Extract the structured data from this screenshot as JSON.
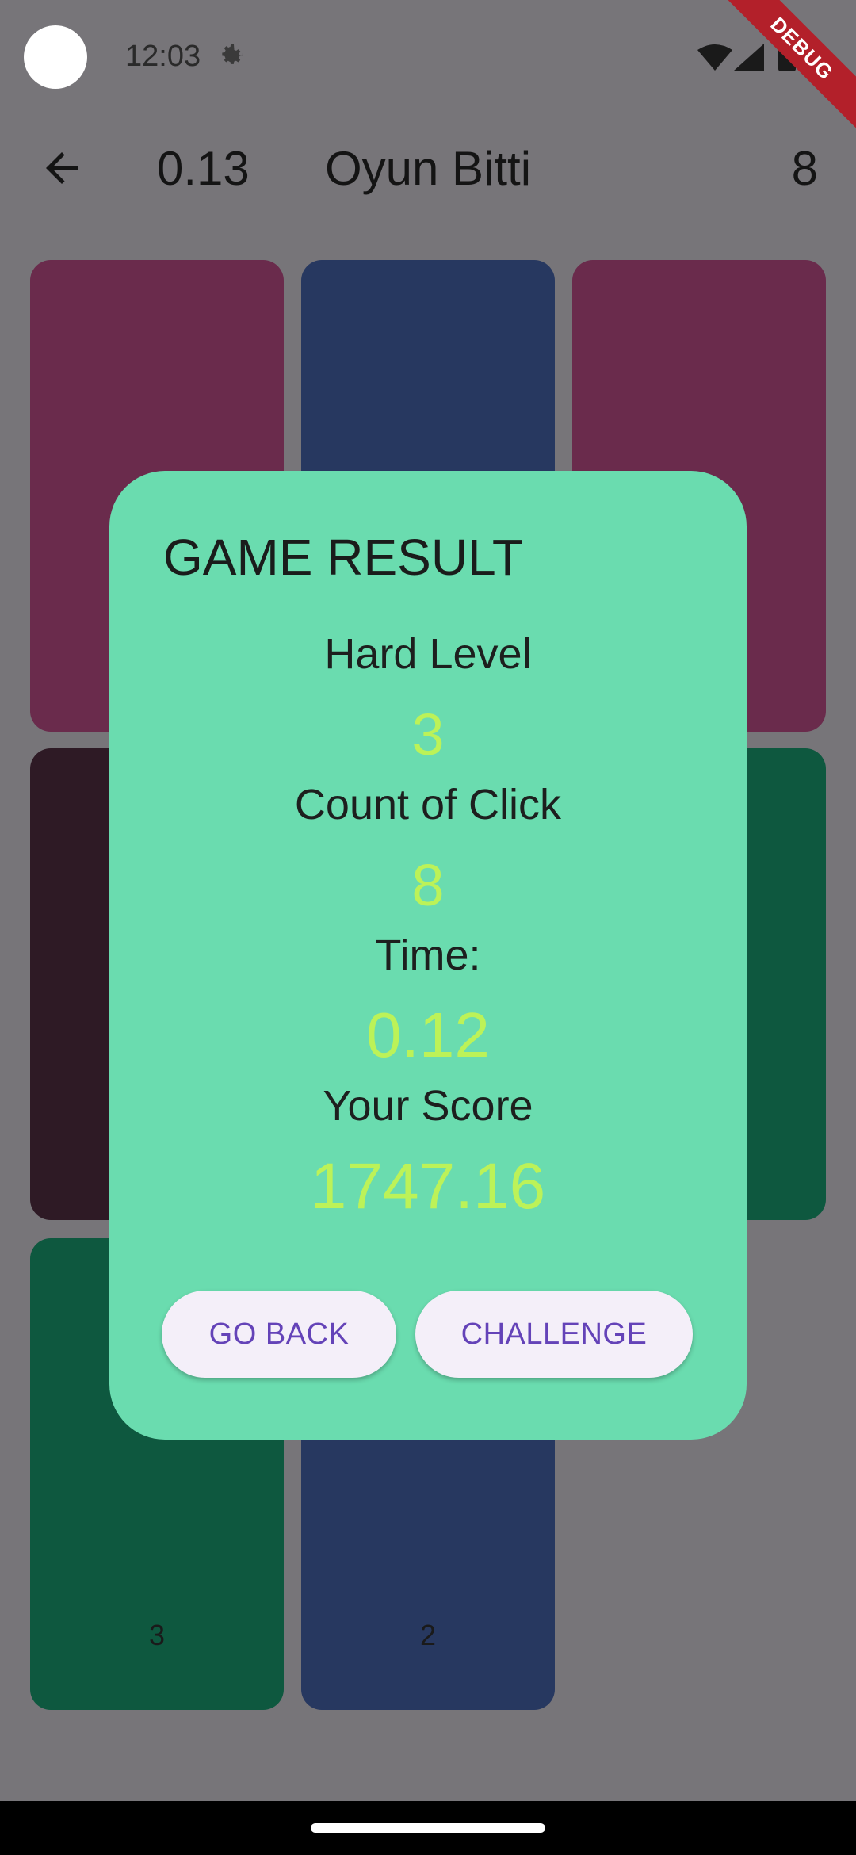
{
  "status_bar": {
    "time": "12:03",
    "icons": [
      "gear-icon",
      "wifi-icon",
      "signal-icon",
      "battery-icon"
    ],
    "debug_label": "DEBUG"
  },
  "app_bar": {
    "back_icon": "arrow-left-icon",
    "time_value": "0.13",
    "title": "Oyun Bitti",
    "click_count": "8"
  },
  "tiles": [
    {
      "color": "#6a2b4c",
      "label": ""
    },
    {
      "color": "#273860",
      "label": ""
    },
    {
      "color": "#6a2b4c",
      "label": ""
    },
    {
      "color": "#2e1a25",
      "label": ""
    },
    {
      "color": "#0e583f",
      "label": ""
    },
    {
      "color": "#0e583f",
      "label": ""
    },
    {
      "color": "#0e583f",
      "label": "3"
    },
    {
      "color": "#273860",
      "label": "2"
    }
  ],
  "dialog": {
    "title": "GAME RESULT",
    "level_label": "Hard Level",
    "level_value": "3",
    "clicks_label": "Count of Click",
    "clicks_value": "8",
    "time_label": "Time:",
    "time_value": "0.12",
    "score_label": "Your Score",
    "score_value": "1747.16",
    "go_back_label": "GO BACK",
    "challenge_label": "CHALLENGE"
  },
  "colors": {
    "background": "#777579",
    "dialog": "#6adcaf",
    "value_accent": "#bcf258",
    "button_bg": "#f4eff9",
    "button_text": "#6443b8"
  }
}
